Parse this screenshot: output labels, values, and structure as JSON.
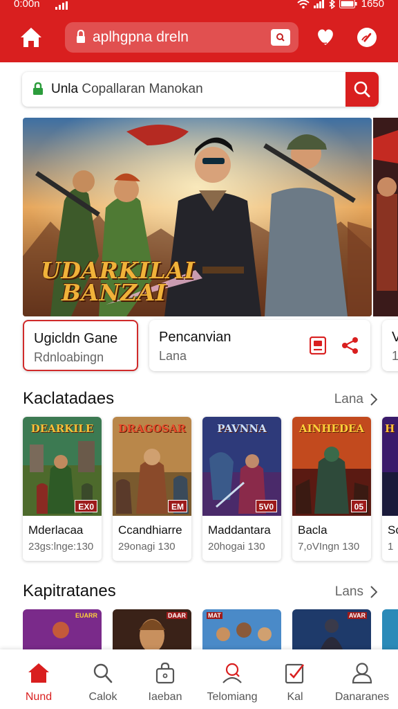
{
  "status_bar": {
    "time": "0:00n",
    "clock": "1650"
  },
  "url_bar": {
    "url": "aplhgpna dreln"
  },
  "search": {
    "prefix": "Unla",
    "query": "Copallaran Manokan"
  },
  "hero": {
    "title_line1": "UDARKILAI",
    "title_line2": "BANZAI"
  },
  "hero_cards": [
    {
      "title": "Ugicldn Gane",
      "subtitle": "Rdnloabingn"
    },
    {
      "title": "Pencanvian",
      "subtitle": "Lana"
    },
    {
      "title": "V",
      "subtitle": "1"
    }
  ],
  "section1": {
    "title": "Kaclatadaes",
    "more": "Lana"
  },
  "games": [
    {
      "logo": "DEARKILE",
      "badge": "EX0",
      "name": "Mderlacaa",
      "meta": "23gs:lnge:130"
    },
    {
      "logo": "DRAGOSAR",
      "badge": "EM",
      "name": "Ccandhiarre",
      "meta": "29onagi 130"
    },
    {
      "logo": "PAVNNA",
      "badge": "5V0",
      "name": "Maddantara",
      "meta": "20hogai 130"
    },
    {
      "logo": "AINHEDEA",
      "badge": "05",
      "name": "Bacla",
      "meta": "7,oVIngn 130"
    },
    {
      "logo": "H",
      "badge": "",
      "name": "So",
      "meta": "1"
    }
  ],
  "section2": {
    "title": "Kapitratanes",
    "more": "Lans"
  },
  "row2_tiles": [
    "EUARR",
    "DAAR",
    "MAT",
    "AVAR"
  ],
  "nav": [
    {
      "label": "Nund",
      "icon": "home-icon"
    },
    {
      "label": "Calok",
      "icon": "search-icon"
    },
    {
      "label": "Iaeban",
      "icon": "bag-icon"
    },
    {
      "label": "Telomiang",
      "icon": "profile-pin-icon"
    },
    {
      "label": "Kal",
      "icon": "checklist-icon"
    },
    {
      "label": "Danaranes",
      "icon": "user-icon"
    }
  ],
  "colors": {
    "brand": "#d91f1f",
    "badge": "#9d1b1b"
  }
}
